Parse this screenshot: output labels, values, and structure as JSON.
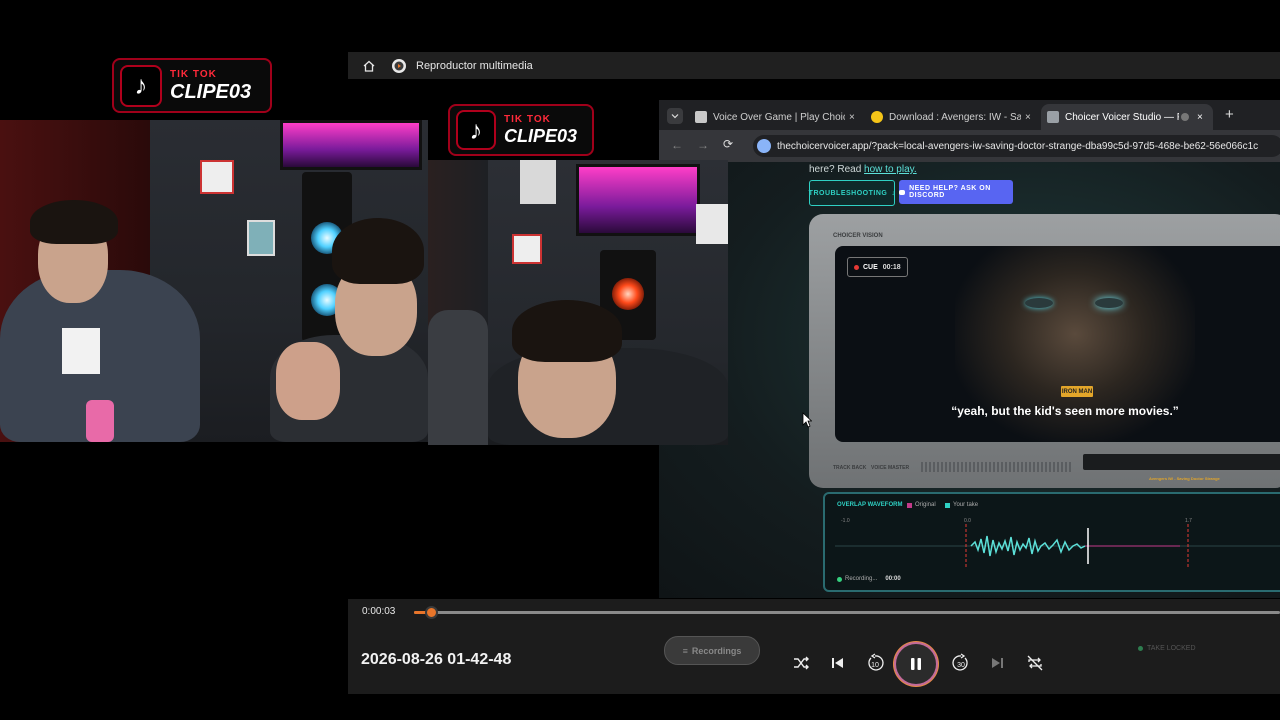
{
  "player": {
    "title": "Reproductor multimedia",
    "time_current": "0:00:03",
    "progress_fraction": 0.02,
    "media_title": "2026-08-26 01-42-48",
    "controls": [
      "shuffle-icon",
      "previous-icon",
      "rewind-10-icon",
      "pause-icon",
      "forward-30-icon",
      "next-icon",
      "repeat-off-icon"
    ],
    "rewind_label": "10",
    "forward_label": "30"
  },
  "tiktok_badges": [
    {
      "small": "TIK TOK",
      "big": "CLIPE03"
    },
    {
      "small": "TIK TOK",
      "big": "CLIPE03"
    }
  ],
  "browser": {
    "tabs": [
      {
        "label": "Voice Over Game | Play Choicer",
        "favicon_color": "#c8c8c8"
      },
      {
        "label": "Download : Avengers: IW - Sav",
        "favicon_color": "#f5c518"
      },
      {
        "label": "Choicer Voicer Studio — Fr",
        "favicon_color": "#9aa0a6"
      }
    ],
    "url": "thechoicervoicer.app/?pack=local-avengers-iw-saving-doctor-strange-dba99c5d-97d5-468e-be62-56e066c1c",
    "page": {
      "intro_text": "here? Read",
      "intro_link": "how to play.",
      "troubleshooting_label": "TROUBLESHOOTING",
      "help_label": "NEED HELP? ASK ON DISCORD",
      "device_header": "CHOICER VISION",
      "cue_label": "CUE",
      "cue_time": "00:18",
      "speaker": "IRON MAN",
      "subtitle": "“yeah, but the kid's seen more movies.”",
      "device_footer_left": "TRACK BACK",
      "device_footer_mid": "VOICE MASTER",
      "device_footer_right": "Avengers IW - Saving Doctor Strange",
      "overlap_title": "OVERLAP WAVEFORM",
      "legend_original": "Original",
      "legend_take": "Your take",
      "tick_left": "-1.0",
      "tick_mid": "0.0",
      "tick_right": "1.7",
      "recording_label": "Recording...",
      "recording_time": "00:00",
      "recordings_button": "Recordings",
      "take_label": "TAKE LOCKED"
    }
  },
  "colors": {
    "accent_orange": "#e8752a",
    "tiktok_red": "#ff2a3a",
    "teal": "#2fd1c4",
    "discord": "#5865f2"
  }
}
